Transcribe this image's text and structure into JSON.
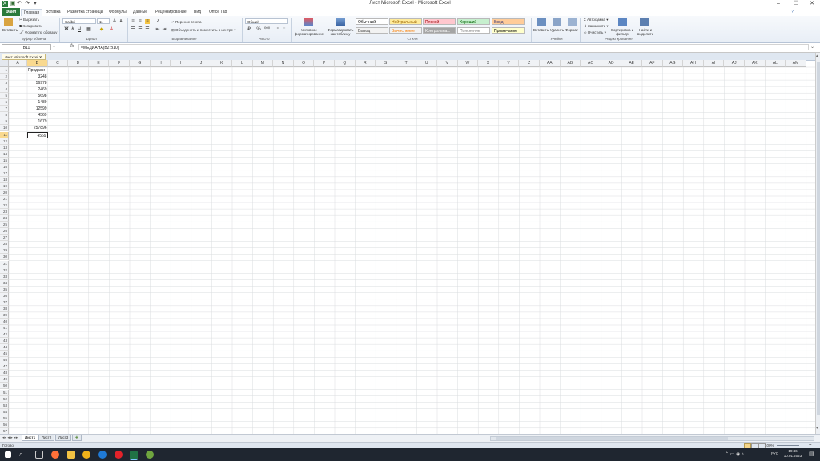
{
  "window": {
    "title": "Лист Microsoft Excel - Microsoft Excel",
    "controls": {
      "minimize": "‒",
      "maximize": "☐",
      "close": "✕"
    }
  },
  "ribbon_tabs": [
    "Файл",
    "Главная",
    "Вставка",
    "Разметка страницы",
    "Формулы",
    "Данные",
    "Рецензирование",
    "Вид",
    "Office Tab"
  ],
  "ribbon": {
    "clipboard": {
      "paste": "Вставить",
      "cut": "Вырезать",
      "copy": "Копировать",
      "format_painter": "Формат по образцу",
      "label": "Буфер обмена"
    },
    "font": {
      "name": "Calibri",
      "size": "11",
      "bold": "Ж",
      "italic": "К",
      "underline": "Ч",
      "label": "Шрифт"
    },
    "alignment": {
      "wrap": "Перенос текста",
      "merge": "Объединить и поместить в центре",
      "label": "Выравнивание"
    },
    "number": {
      "format": "Общий",
      "label": "Число"
    },
    "styles": {
      "conditional": "Условное форматирование",
      "as_table": "Форматировать как таблицу",
      "items": [
        {
          "name": "Обычный",
          "bg": "#ffffff",
          "fg": "#000000"
        },
        {
          "name": "Нейтральный",
          "bg": "#ffeb9c",
          "fg": "#9c6500"
        },
        {
          "name": "Плохой",
          "bg": "#ffc7ce",
          "fg": "#9c0006"
        },
        {
          "name": "Хороший",
          "bg": "#c6efce",
          "fg": "#006100"
        },
        {
          "name": "Ввод",
          "bg": "#ffcc99",
          "fg": "#3f3f76"
        },
        {
          "name": "Вывод",
          "bg": "#f2f2f2",
          "fg": "#3f3f3f"
        },
        {
          "name": "Вычисление",
          "bg": "#f2f2f2",
          "fg": "#fa7d00"
        },
        {
          "name": "Контрольна...",
          "bg": "#a5a5a5",
          "fg": "#ffffff"
        },
        {
          "name": "Пояснение",
          "bg": "#ffffff",
          "fg": "#7f7f7f"
        },
        {
          "name": "Примечание",
          "bg": "#ffffcc",
          "fg": "#000000"
        }
      ],
      "label": "Стили"
    },
    "cells": {
      "insert": "Вставить",
      "delete": "Удалить",
      "format": "Формат",
      "label": "Ячейки"
    },
    "editing": {
      "autosum": "Автосумма",
      "fill": "Заполнить",
      "clear": "Очистить",
      "sort": "Сортировка и фильтр",
      "find": "Найти и выделить",
      "label": "Редактирование"
    }
  },
  "formula_bar": {
    "name_box": "B11",
    "fx": "fx",
    "formula": "=МЕДИАНА(B2:B10)"
  },
  "workbook_tab": "Лист Microsoft Excel",
  "columns": [
    "A",
    "B",
    "C",
    "D",
    "E",
    "F",
    "G",
    "H",
    "I",
    "J",
    "K",
    "L",
    "M",
    "N",
    "O",
    "P",
    "Q",
    "R",
    "S",
    "T",
    "U",
    "V",
    "W",
    "X",
    "Y",
    "Z",
    "AA",
    "AB",
    "AC",
    "AD",
    "AE",
    "AF",
    "AG",
    "AH",
    "AI",
    "AJ",
    "AK",
    "AL",
    "AM"
  ],
  "selected_column": "B",
  "selected_row": "11",
  "rows": 57,
  "cells": {
    "header": "Продажи",
    "values": [
      "3248",
      "56978",
      "2469",
      "5698",
      "1489",
      "12599",
      "4569",
      "1679",
      "257896"
    ],
    "median": "4569"
  },
  "sheets": [
    "Лист1",
    "Лист2",
    "Лист3"
  ],
  "active_sheet": "Лист1",
  "status": {
    "ready": "Готово",
    "zoom": "100%"
  },
  "taskbar": {
    "time": "19:46",
    "date": "10.01.2023",
    "lang": "РУС"
  }
}
